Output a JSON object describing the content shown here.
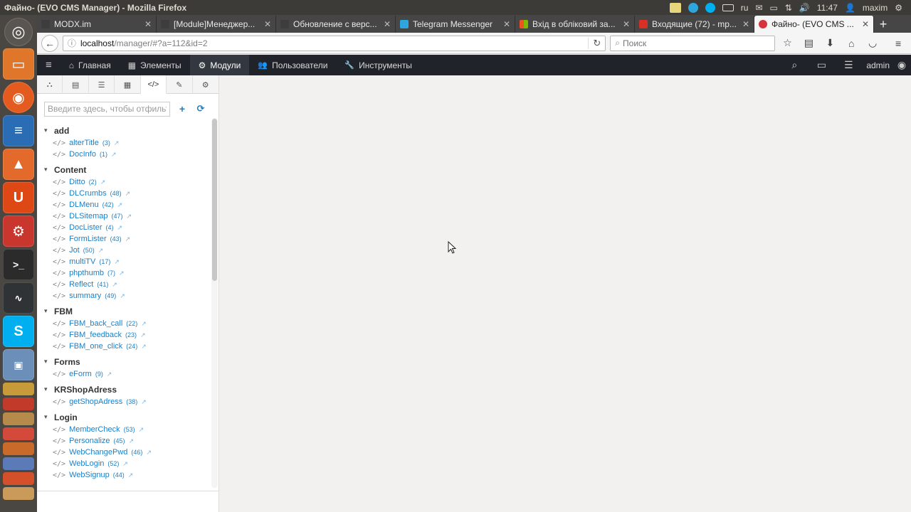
{
  "os_panel": {
    "window_title": "Файно- (EVO CMS Manager) - Mozilla Firefox",
    "keyboard_layout": "ru",
    "clock": "11:47",
    "user": "maxim",
    "tray_icons": [
      "mail-icon",
      "telegram-icon",
      "skype-tray-icon",
      "keyboard-icon",
      "layout-icon",
      "envelope-icon",
      "battery-icon",
      "network-icon",
      "volume-icon",
      "user-icon"
    ]
  },
  "launcher": {
    "items": [
      "ubuntu-dash",
      "files",
      "firefox",
      "writer",
      "software-center",
      "ubuntu-one",
      "settings",
      "terminal",
      "system-monitor",
      "skype",
      "remote-desktop"
    ]
  },
  "browser": {
    "tabs": [
      {
        "label": "MODX.im",
        "favicon_color": "#3d3d3d"
      },
      {
        "label": "[Module]Менеджер...",
        "favicon_color": "#3d3d3d"
      },
      {
        "label": "Обновление с верс...",
        "favicon_color": "#3d3d3d"
      },
      {
        "label": "Telegram Messenger",
        "favicon_color": "#2ea6dd"
      },
      {
        "label": "Вхід в обліковий за...",
        "favicon_color": "#f25022"
      },
      {
        "label": "Входящие (72) - mp...",
        "favicon_color": "#d93025"
      },
      {
        "label": "Файно- (EVO CMS ...",
        "favicon_color": "#d8323a"
      }
    ],
    "active_tab_index": 6,
    "new_tab_label": "+",
    "url_host": "localhost",
    "url_path": "/manager/#?a=112&id=2",
    "search_placeholder": "Поиск"
  },
  "evo_nav": {
    "items": [
      {
        "label": "Главная",
        "icon": "home-icon",
        "glyph": "⌂"
      },
      {
        "label": "Элементы",
        "icon": "grid-icon",
        "glyph": "▦"
      },
      {
        "label": "Модули",
        "icon": "cogs-icon",
        "glyph": "⚙"
      },
      {
        "label": "Пользователи",
        "icon": "users-icon",
        "glyph": "👥"
      },
      {
        "label": "Инструменты",
        "icon": "wrench-icon",
        "glyph": "🔧"
      }
    ],
    "active_index": 2,
    "admin_label": "admin"
  },
  "sidebar": {
    "tabs": [
      "sitemap-icon",
      "resources-icon",
      "list-icon",
      "blocks-icon",
      "code-icon",
      "plugin-icon",
      "modules-icon"
    ],
    "active_tab_index": 4,
    "filter_placeholder": "Введите здесь, чтобы отфильтровать",
    "categories": [
      {
        "name": "add",
        "items": [
          {
            "name": "alterTitle",
            "id": "(3)"
          },
          {
            "name": "DocInfo",
            "id": "(1)"
          }
        ]
      },
      {
        "name": "Content",
        "items": [
          {
            "name": "Ditto",
            "id": "(2)"
          },
          {
            "name": "DLCrumbs",
            "id": "(48)"
          },
          {
            "name": "DLMenu",
            "id": "(42)"
          },
          {
            "name": "DLSitemap",
            "id": "(47)"
          },
          {
            "name": "DocLister",
            "id": "(4)"
          },
          {
            "name": "FormLister",
            "id": "(43)"
          },
          {
            "name": "Jot",
            "id": "(50)"
          },
          {
            "name": "multiTV",
            "id": "(17)"
          },
          {
            "name": "phpthumb",
            "id": "(7)"
          },
          {
            "name": "Reflect",
            "id": "(41)"
          },
          {
            "name": "summary",
            "id": "(49)"
          }
        ]
      },
      {
        "name": "FBM",
        "items": [
          {
            "name": "FBM_back_call",
            "id": "(22)"
          },
          {
            "name": "FBM_feedback",
            "id": "(23)"
          },
          {
            "name": "FBM_one_click",
            "id": "(24)"
          }
        ]
      },
      {
        "name": "Forms",
        "items": [
          {
            "name": "eForm",
            "id": "(9)"
          }
        ]
      },
      {
        "name": "KRShopAdress",
        "items": [
          {
            "name": "getShopAdress",
            "id": "(38)"
          }
        ]
      },
      {
        "name": "Login",
        "items": [
          {
            "name": "MemberCheck",
            "id": "(53)"
          },
          {
            "name": "Personalize",
            "id": "(45)"
          },
          {
            "name": "WebChangePwd",
            "id": "(46)"
          },
          {
            "name": "WebLogin",
            "id": "(52)"
          },
          {
            "name": "WebSignup",
            "id": "(44)"
          }
        ]
      }
    ]
  }
}
